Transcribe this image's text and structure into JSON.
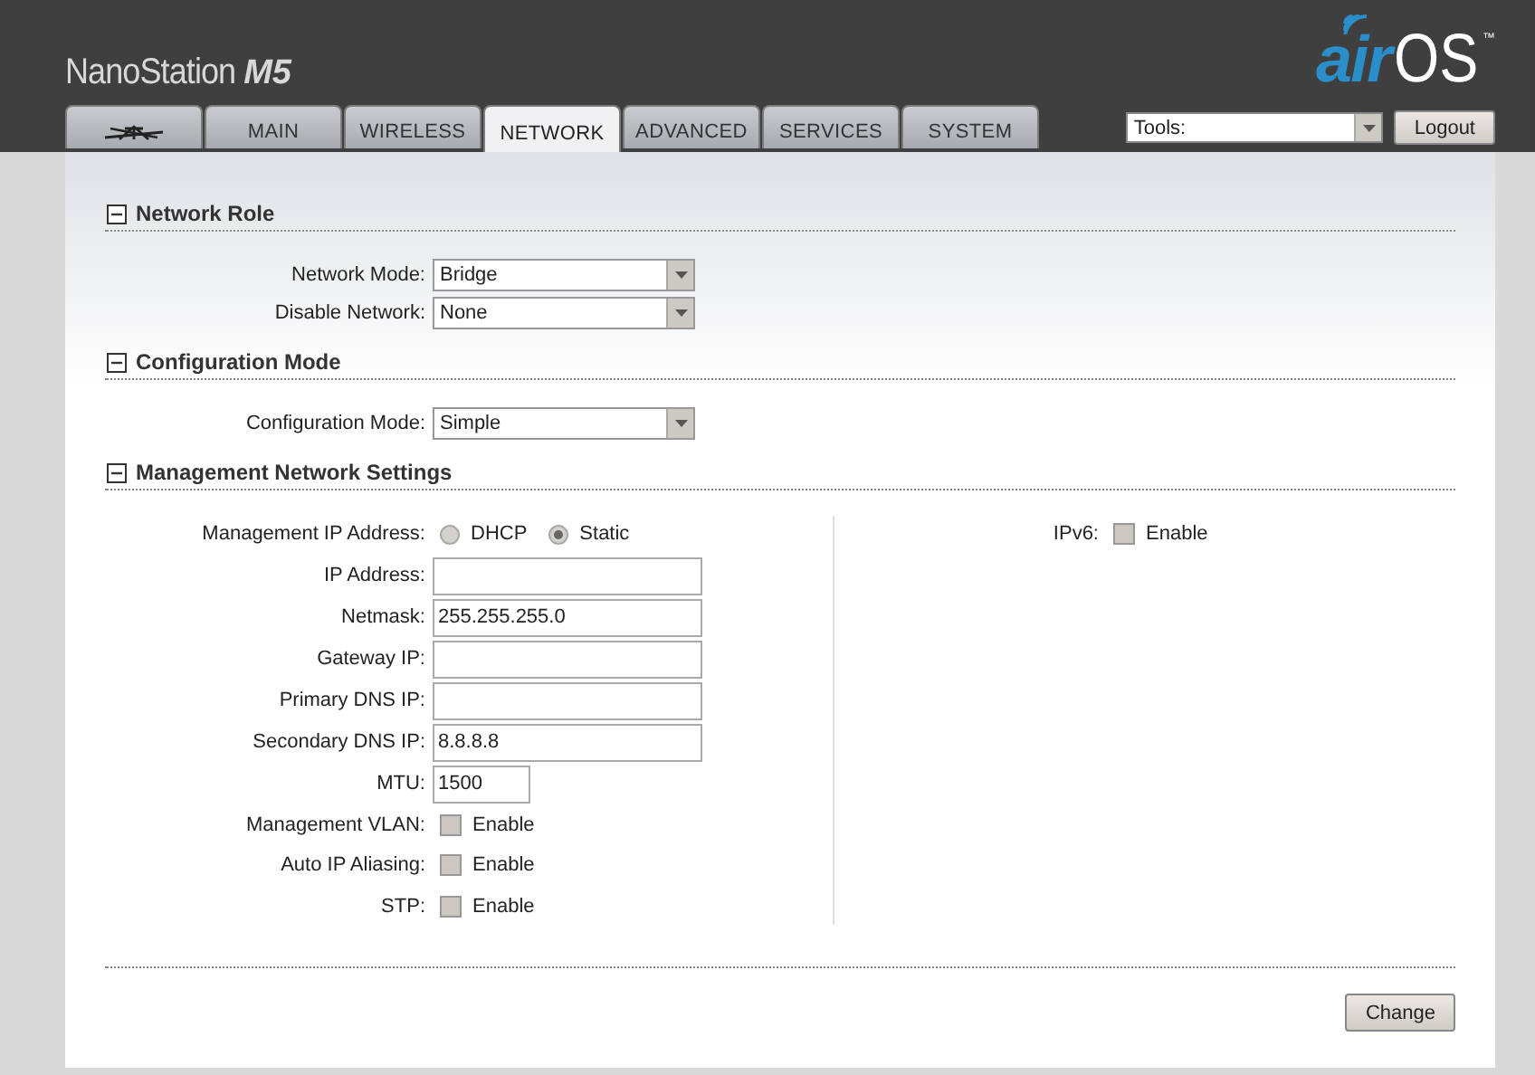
{
  "header": {
    "product": "NanoStation",
    "model": "M5",
    "logo": {
      "part_1": "air",
      "part_2": "OS",
      "mark": "™"
    }
  },
  "tabs": [
    {
      "kind": "icon",
      "selected": false
    },
    {
      "kind": "text",
      "label": "MAIN",
      "selected": false
    },
    {
      "kind": "text",
      "label": "WIRELESS",
      "selected": false
    },
    {
      "kind": "text",
      "label": "NETWORK",
      "selected": true
    },
    {
      "kind": "text",
      "label": "ADVANCED",
      "selected": false
    },
    {
      "kind": "text",
      "label": "SERVICES",
      "selected": false
    },
    {
      "kind": "text",
      "label": "SYSTEM",
      "selected": false
    }
  ],
  "tools": {
    "value": "Tools:"
  },
  "logout_button": "Logout",
  "sections": [
    {
      "title": "Network Role",
      "expanded": true,
      "left": [
        {
          "kind": "select",
          "label": "Network Mode:",
          "value": "Bridge"
        },
        {
          "kind": "select",
          "label": "Disable Network:",
          "value": "None"
        }
      ]
    },
    {
      "title": "Configuration Mode",
      "expanded": true,
      "left": [
        {
          "kind": "select",
          "label": "Configuration Mode:",
          "value": "Simple"
        }
      ]
    },
    {
      "title": "Management Network Settings",
      "expanded": true,
      "left": [
        {
          "kind": "radio",
          "label": "Management IP Address:",
          "options": [
            {
              "label": "DHCP",
              "selected": false
            },
            {
              "label": "Static",
              "selected": true
            }
          ]
        },
        {
          "kind": "input",
          "label": "IP Address:"
        },
        {
          "kind": "input",
          "label": "Netmask:",
          "value": "255.255.255.0"
        },
        {
          "kind": "input",
          "label": "Gateway IP:"
        },
        {
          "kind": "input",
          "label": "Primary DNS IP:"
        },
        {
          "kind": "input",
          "label": "Secondary DNS IP:",
          "value": "8.8.8.8"
        },
        {
          "kind": "short_input",
          "label": "MTU:",
          "value": "1500"
        },
        {
          "kind": "checkbox",
          "label": "Management VLAN:",
          "text": "Enable",
          "checked": false
        },
        {
          "kind": "checkbox",
          "label": "Auto IP Aliasing:",
          "text": "Enable",
          "checked": false
        },
        {
          "kind": "checkbox",
          "label": "STP:",
          "text": "Enable",
          "checked": false
        }
      ],
      "right": [
        {
          "kind": "checkbox",
          "label": "IPv6:",
          "text": "Enable",
          "checked": false
        }
      ]
    }
  ],
  "change_button": "Change"
}
